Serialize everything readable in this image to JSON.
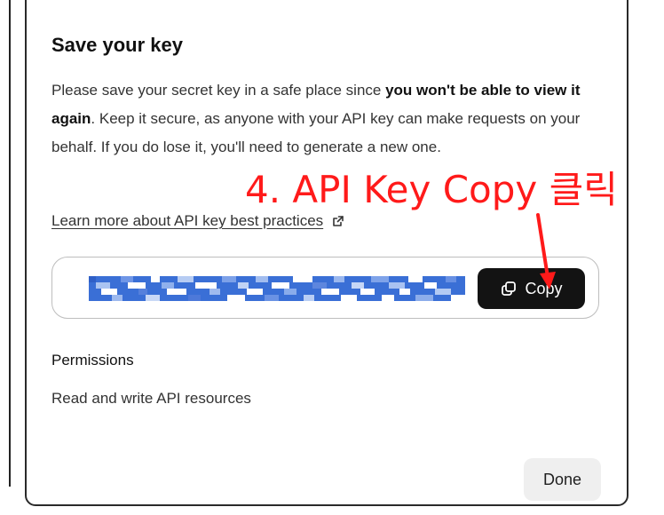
{
  "dialog": {
    "title": "Save your key",
    "description": {
      "part1": "Please save your secret key in a safe place since ",
      "bold": "you won't be able to view it again",
      "part2": ". Keep it secure, as anyone with your API key can make requests on your behalf. If you do lose it, you'll need to generate a new one."
    },
    "learn_more_link": "Learn more about API key best practices",
    "copy_label": "Copy",
    "permissions_title": "Permissions",
    "permissions_value": "Read and write API resources",
    "done_label": "Done"
  },
  "annotation": {
    "text": "4. API Key Copy 클릭",
    "color": "#ff1a1a"
  },
  "colors": {
    "copy_button_bg": "#131313",
    "done_button_bg": "#efefef",
    "redaction_blue": "#3a6fd6",
    "border": "#2a2a2a"
  },
  "icons": {
    "external_link": "external-link-icon",
    "copy": "copy-icon"
  }
}
